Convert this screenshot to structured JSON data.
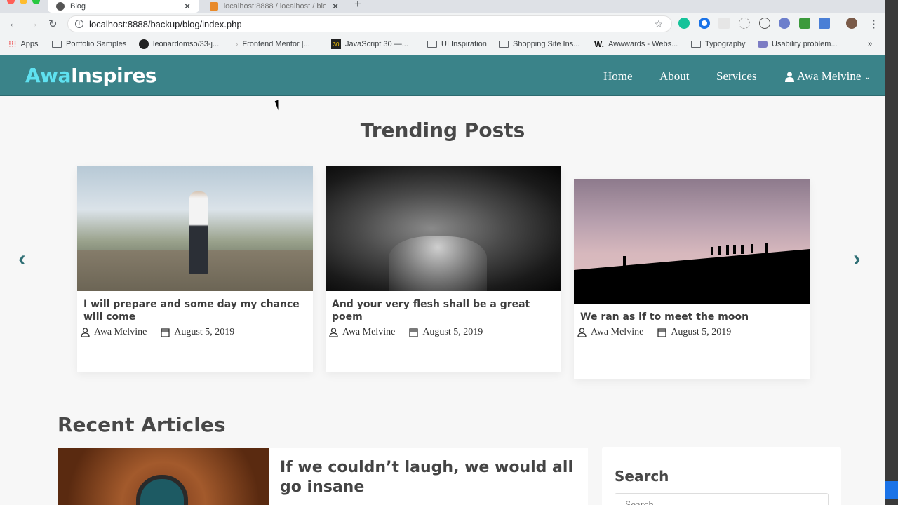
{
  "browser": {
    "tabs": [
      {
        "title": "Blog",
        "active": true
      },
      {
        "title": "localhost:8888 / localhost / blo",
        "active": false
      }
    ],
    "url": "localhost:8888/backup/blog/index.php",
    "bookmarks": [
      "Apps",
      "Portfolio Samples",
      "leonardomso/33-j...",
      "Frontend Mentor |...",
      "JavaScript 30 —...",
      "UI Inspiration",
      "Shopping Site Ins...",
      "Awwwards - Webs...",
      "Typography",
      "Usability problem..."
    ],
    "more": "»"
  },
  "site": {
    "logo": {
      "accent": "Awa",
      "rest": "Inspires"
    },
    "nav": [
      "Home",
      "About",
      "Services"
    ],
    "user": "Awa Melvine",
    "colors": {
      "navbar": "#3a8389",
      "logo_accent": "#5fe1f0"
    }
  },
  "trending": {
    "title": "Trending Posts",
    "posts": [
      {
        "title": "I will prepare and some day my chance will come",
        "author": "Awa Melvine",
        "date": "August 5, 2019",
        "image": "man-on-cliff"
      },
      {
        "title": "And your very flesh shall be a great poem",
        "author": "Awa Melvine",
        "date": "August 5, 2019",
        "image": "old-man-portrait"
      },
      {
        "title": "We ran as if to meet the moon",
        "author": "Awa Melvine",
        "date": "August 5, 2019",
        "image": "silhouettes-sunset"
      }
    ]
  },
  "recent": {
    "title": "Recent Articles",
    "articles": [
      {
        "title": "If we couldn’t laugh, we would all go insane"
      }
    ]
  },
  "sidebar": {
    "search_title": "Search",
    "search_placeholder": "Search..."
  }
}
